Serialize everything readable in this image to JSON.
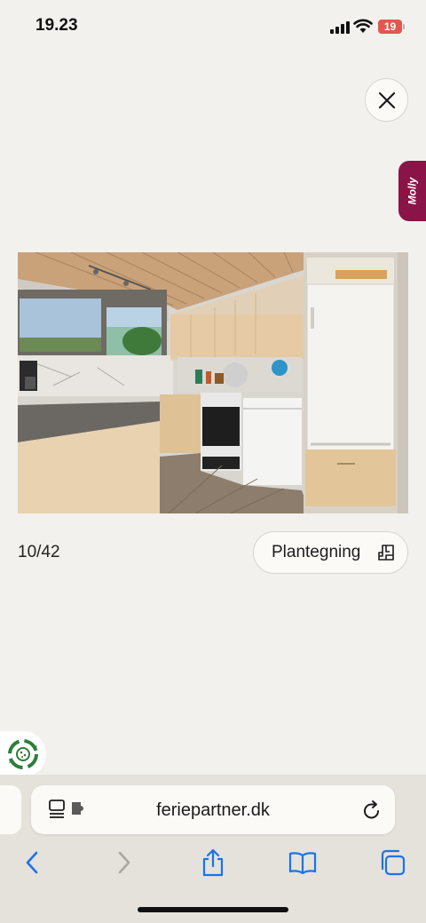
{
  "status_bar": {
    "time": "19.23",
    "battery_level": "19",
    "battery_color": "#e4574f"
  },
  "viewer": {
    "close_icon": "close-icon",
    "photo_alt": "Køkken",
    "counter": "10/42",
    "floorplan_label": "Plantegning",
    "floorplan_icon": "floorplan-icon"
  },
  "chat": {
    "label": "Molly",
    "color": "#8a1447"
  },
  "cookie": {
    "icon": "cookie-settings-icon",
    "color": "#2e7d3a"
  },
  "safari": {
    "url": "feriepartner.dk",
    "reader_icon": "page-menu-icon",
    "reload_icon": "reload-icon",
    "toolbar": [
      "back-icon",
      "forward-icon",
      "share-icon",
      "bookmarks-icon",
      "tabs-icon"
    ],
    "accent": "#1a73e8"
  }
}
